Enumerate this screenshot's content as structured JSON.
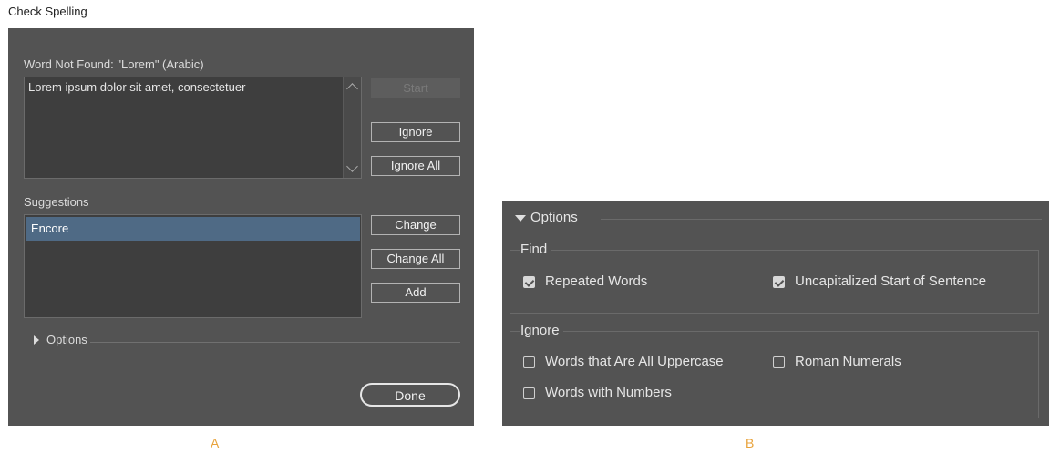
{
  "window_title": "Check Spelling",
  "dialog": {
    "word_not_found_label": "Word Not Found: \"Lorem\" (Arabic)",
    "context_text": "Lorem ipsum dolor sit amet, consectetuer",
    "start_label": "Start",
    "ignore_label": "Ignore",
    "ignore_all_label": "Ignore All",
    "suggestions_label": "Suggestions",
    "suggestions": [
      "Encore"
    ],
    "change_label": "Change",
    "change_all_label": "Change All",
    "add_label": "Add",
    "options_label": "Options",
    "done_label": "Done"
  },
  "options_panel": {
    "header": "Options",
    "find": {
      "legend": "Find",
      "items": [
        {
          "label": "Repeated Words",
          "checked": true
        },
        {
          "label": "Uncapitalized Start of Sentence",
          "checked": true
        }
      ]
    },
    "ignore": {
      "legend": "Ignore",
      "items": [
        {
          "label": "Words that Are All Uppercase",
          "checked": false
        },
        {
          "label": "Roman Numerals",
          "checked": false
        },
        {
          "label": "Words with Numbers",
          "checked": false
        }
      ]
    }
  },
  "captions": {
    "a": "A",
    "b": "B"
  }
}
